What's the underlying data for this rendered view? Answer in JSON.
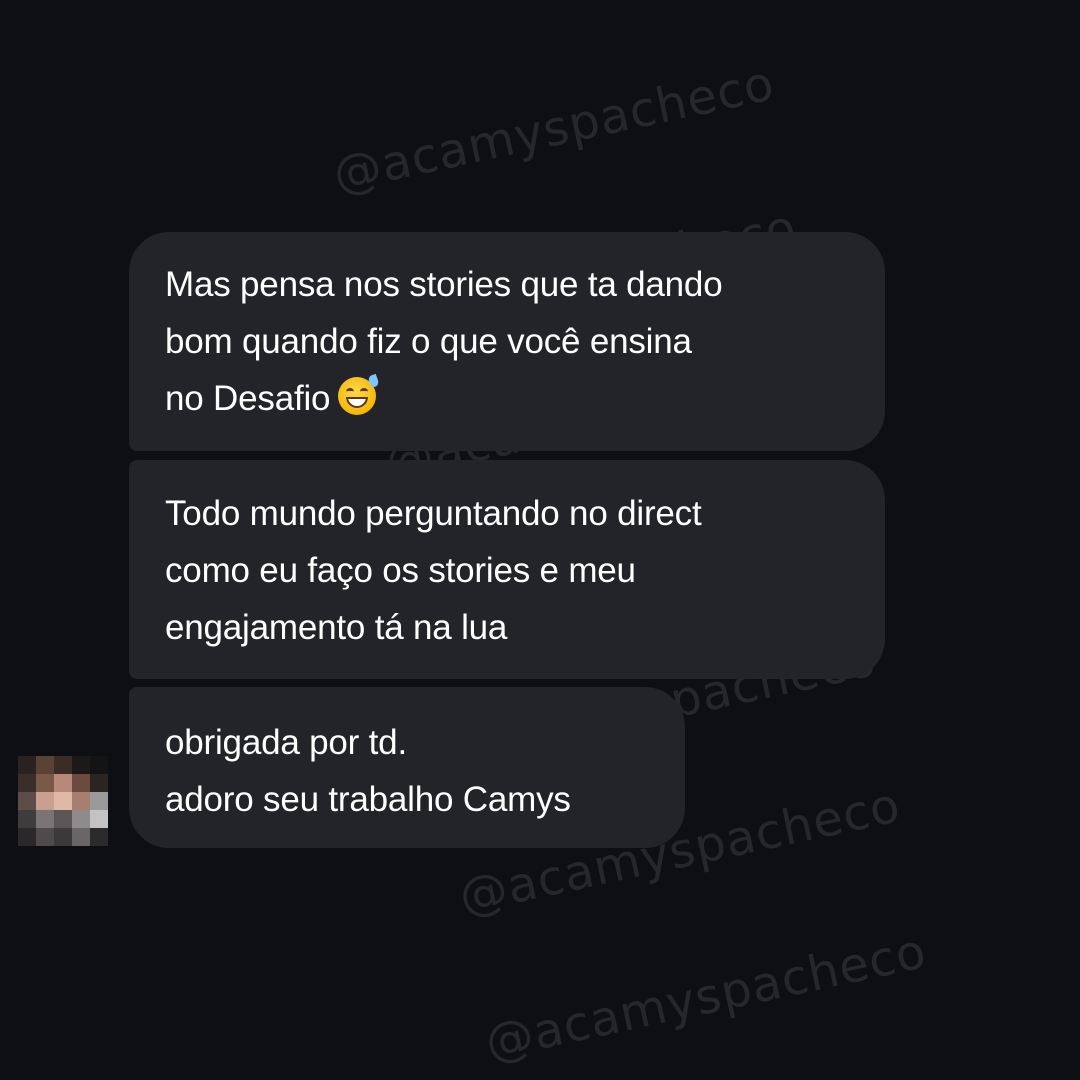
{
  "messages": [
    {
      "lines": [
        "Mas pensa nos stories que ta dando",
        "bom quando fiz o que você ensina",
        "no Desafio"
      ],
      "emoji": "grinning-face-with-sweat"
    },
    {
      "lines": [
        "Todo mundo perguntando no direct",
        "como eu faço os stories e meu",
        "engajamento tá na lua"
      ]
    },
    {
      "lines": [
        "obrigada por td.",
        "adoro seu trabalho Camys"
      ]
    }
  ],
  "watermark": "@acamyspacheco",
  "colors": {
    "background": "#0e0f12",
    "bubble": "#222429",
    "text": "#ffffff"
  },
  "avatar": {
    "icon": "pixelated-avatar",
    "pixels": [
      "#2a2220",
      "#5a4236",
      "#3b2c26",
      "#1c1a19",
      "#151414",
      "#3a2e2a",
      "#7a5848",
      "#b8897a",
      "#6b4b3e",
      "#2a2523",
      "#5d4c48",
      "#c9a08f",
      "#e0b9a6",
      "#a77e70",
      "#9a9a9a",
      "#3e3c3d",
      "#7a7476",
      "#5a5557",
      "#8e8b8c",
      "#c4c2c2",
      "#2a2829",
      "#4f4b4d",
      "#3b393a",
      "#6a6667",
      "#2c2b2b"
    ]
  }
}
